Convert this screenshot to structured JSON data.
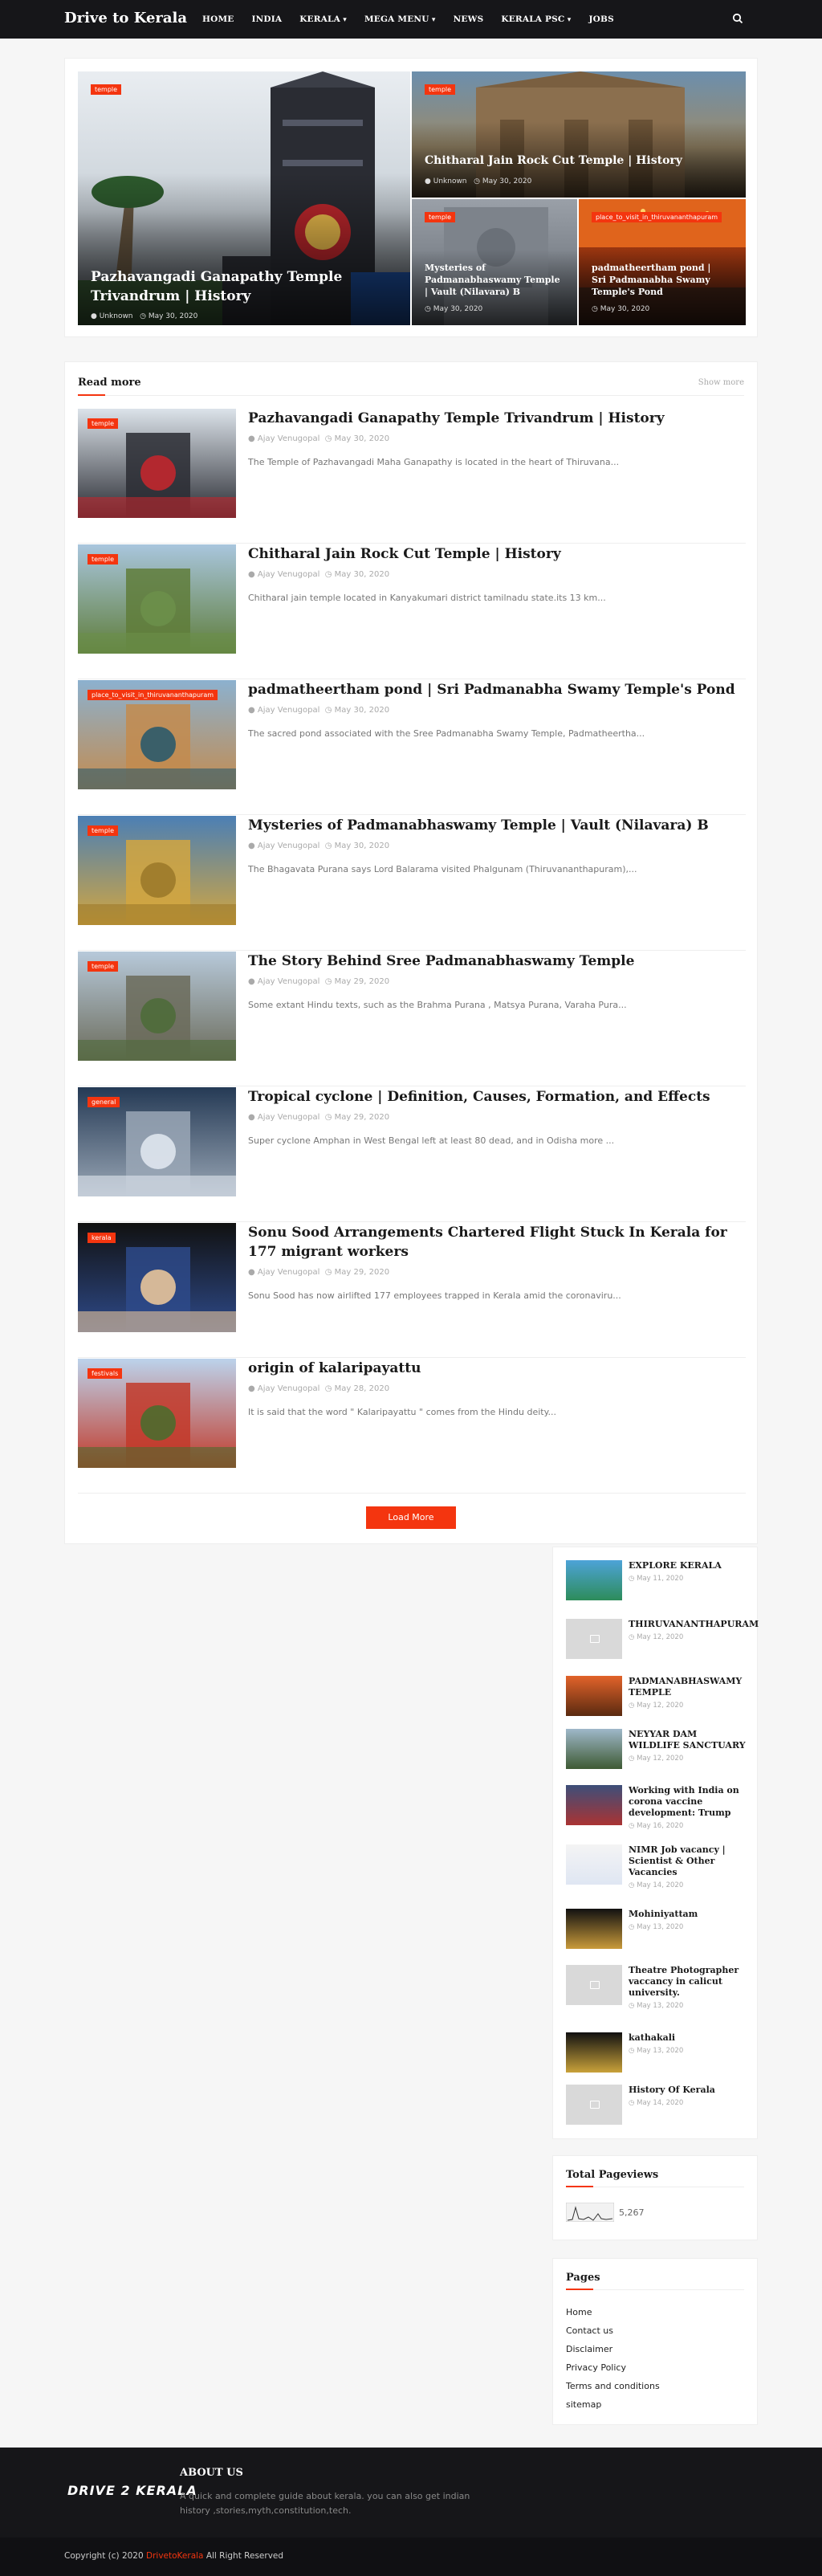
{
  "nav": {
    "brand": "Drive to Kerala",
    "menu": [
      "HOME",
      "INDIA",
      "KERALA",
      "MEGA MENU",
      "NEWS",
      "KERALA PSC",
      "JOBS"
    ]
  },
  "featured": [
    {
      "tag": "temple",
      "title": "Pazhavangadi Ganapathy Temple Trivandrum | History",
      "author": "Unknown",
      "date": "May 30, 2020"
    },
    {
      "tag": "temple",
      "title": "Chitharal Jain Rock Cut Temple | History",
      "author": "Unknown",
      "date": "May 30, 2020"
    },
    {
      "tag": "temple",
      "title": "Mysteries of Padmanabhaswamy Temple | Vault (Nilavara) B",
      "author": "",
      "date": "May 30, 2020"
    },
    {
      "tag": "place_to_visit_in_thiruvananthapuram",
      "title": "padmatheertham pond | Sri Padmanabha Swamy Temple's Pond",
      "author": "",
      "date": "May 30, 2020"
    }
  ],
  "readmore": {
    "heading": "Read more",
    "show_more": "Show more",
    "load_more": "Load More",
    "posts": [
      {
        "tag": "temple",
        "title": "Pazhavangadi Ganapathy Temple Trivandrum | History",
        "author": "Ajay Venugopal",
        "date": "May 30, 2020",
        "excerpt": "The Temple of Pazhavangadi Maha Ganapathy is located in the heart of Thiruvana..."
      },
      {
        "tag": "temple",
        "title": "Chitharal Jain Rock Cut Temple | History",
        "author": "Ajay Venugopal",
        "date": "May 30, 2020",
        "excerpt": "Chitharal jain temple located in Kanyakumari district tamilnadu state.its 13 km..."
      },
      {
        "tag": "place_to_visit_in_thiruvananthapuram",
        "title": "padmatheertham pond | Sri Padmanabha Swamy Temple's Pond",
        "author": "Ajay Venugopal",
        "date": "May 30, 2020",
        "excerpt": "The sacred pond associated with the Sree Padmanabha Swamy Temple, Padmatheertha..."
      },
      {
        "tag": "temple",
        "title": "Mysteries of Padmanabhaswamy Temple | Vault (Nilavara) B",
        "author": "Ajay Venugopal",
        "date": "May 30, 2020",
        "excerpt": "The Bhagavata Purana says Lord Balarama visited Phalgunam (Thiruvananthapuram),..."
      },
      {
        "tag": "temple",
        "title": "The Story Behind Sree Padmanabhaswamy Temple",
        "author": "Ajay Venugopal",
        "date": "May 29, 2020",
        "excerpt": "Some extant Hindu texts, such as the Brahma Purana , Matsya Purana, Varaha Pura..."
      },
      {
        "tag": "general",
        "title": "Tropical cyclone | Definition, Causes, Formation, and Effects",
        "author": "Ajay Venugopal",
        "date": "May 29, 2020",
        "excerpt": "Super cyclone Amphan in West Bengal left at least 80 dead, and in Odisha more ..."
      },
      {
        "tag": "kerala",
        "title": "Sonu Sood Arrangements Chartered Flight Stuck In Kerala for 177 migrant workers",
        "author": "Ajay Venugopal",
        "date": "May 29, 2020",
        "excerpt": "Sonu Sood has now airlifted 177 employees trapped in Kerala amid the coronaviru..."
      },
      {
        "tag": "festivals",
        "title": "origin of kalaripayattu",
        "author": "Ajay Venugopal",
        "date": "May 28, 2020",
        "excerpt": "It is said that the word \" Kalaripayattu \" comes from the Hindu deity..."
      }
    ]
  },
  "popular": [
    {
      "title": "EXPLORE KERALA",
      "date": "May 11, 2020"
    },
    {
      "title": "THIRUVANANTHAPURAM",
      "date": "May 12, 2020"
    },
    {
      "title": "PADMANABHASWAMY TEMPLE",
      "date": "May 12, 2020"
    },
    {
      "title": "NEYYAR DAM WILDLIFE SANCTUARY",
      "date": "May 12, 2020"
    },
    {
      "title": "Working with India on corona vaccine development: Trump",
      "date": "May 16, 2020"
    },
    {
      "title": "NIMR Job vacancy | Scientist & Other Vacancies",
      "date": "May 14, 2020"
    },
    {
      "title": "Mohiniyattam",
      "date": "May 13, 2020"
    },
    {
      "title": "Theatre Photographer vaccancy in calicut university.",
      "date": "May 13, 2020"
    },
    {
      "title": "kathakali",
      "date": "May 13, 2020"
    },
    {
      "title": "History Of Kerala",
      "date": "May 14, 2020"
    }
  ],
  "pageviews": {
    "title": "Total Pageviews",
    "count": "5,267"
  },
  "pages": {
    "title": "Pages",
    "links": [
      "Home",
      "Contact us",
      "Disclaimer",
      "Privacy Policy",
      "Terms and conditions",
      "sitemap"
    ]
  },
  "footer": {
    "logo": "DRIVE 2 KERALA",
    "about_title": "ABOUT US",
    "about_text": "A quick and complete guide about kerala. you can also get indian history ,stories,myth,constitution,tech.",
    "copyright_prefix": "Copyright (c) 2020",
    "copyright_brand": "DrivetoKerala",
    "copyright_suffix": "All Right Reserved"
  }
}
